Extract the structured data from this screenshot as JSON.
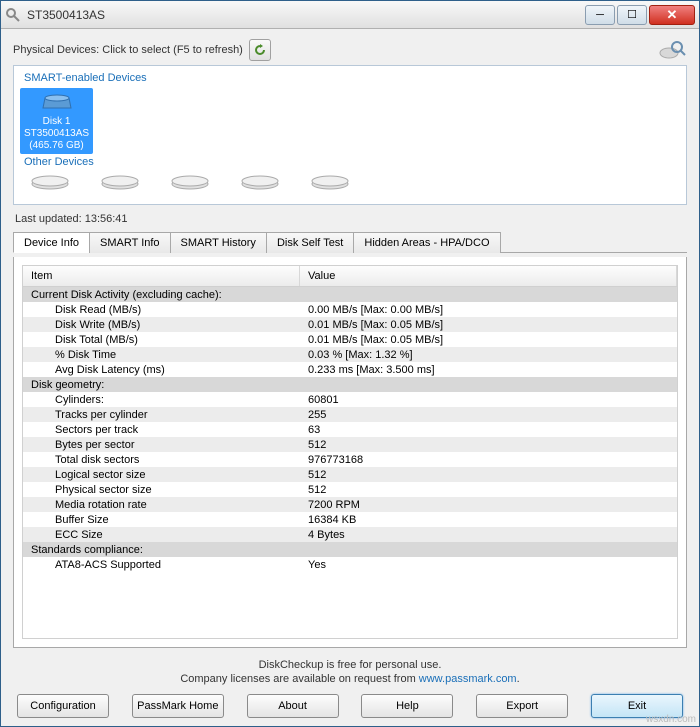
{
  "window": {
    "title": "ST3500413AS"
  },
  "physical": {
    "label": "Physical Devices: Click to select (F5 to refresh)"
  },
  "groups": {
    "smart": "SMART-enabled Devices",
    "other": "Other Devices"
  },
  "selectedDevice": {
    "line1": "Disk 1",
    "line2": "ST3500413AS",
    "line3": "(465.76 GB)"
  },
  "lastUpdated": "Last updated: 13:56:41",
  "tabs": {
    "t0": "Device Info",
    "t1": "SMART Info",
    "t2": "SMART History",
    "t3": "Disk Self Test",
    "t4": "Hidden Areas - HPA/DCO"
  },
  "columns": {
    "item": "Item",
    "value": "Value"
  },
  "rows": {
    "s0": "Current Disk Activity (excluding cache):",
    "r0i": "Disk Read (MB/s)",
    "r0v": "0.00 MB/s   [Max: 0.00 MB/s]",
    "r1i": "Disk Write (MB/s)",
    "r1v": "0.01 MB/s   [Max: 0.05 MB/s]",
    "r2i": "Disk Total (MB/s)",
    "r2v": "0.01 MB/s   [Max: 0.05 MB/s]",
    "r3i": "% Disk Time",
    "r3v": "0.03 %     [Max: 1.32 %]",
    "r4i": "Avg Disk Latency (ms)",
    "r4v": "0.233 ms   [Max: 3.500 ms]",
    "s1": "Disk geometry:",
    "r5i": "Cylinders:",
    "r5v": "60801",
    "r6i": "Tracks per cylinder",
    "r6v": "255",
    "r7i": "Sectors per track",
    "r7v": "63",
    "r8i": "Bytes per sector",
    "r8v": "512",
    "r9i": "Total disk sectors",
    "r9v": "976773168",
    "r10i": "Logical sector size",
    "r10v": "512",
    "r11i": "Physical sector size",
    "r11v": "512",
    "r12i": "Media rotation rate",
    "r12v": "7200 RPM",
    "r13i": "Buffer Size",
    "r13v": "16384 KB",
    "r14i": "ECC Size",
    "r14v": "4 Bytes",
    "s2": "Standards compliance:",
    "r15i": "ATA8-ACS Supported",
    "r15v": "Yes"
  },
  "footer": {
    "line1": "DiskCheckup is free for personal use.",
    "line2a": "Company licenses are available on request from ",
    "link": "www.passmark.com",
    "line2b": "."
  },
  "buttons": {
    "config": "Configuration",
    "home": "PassMark Home",
    "about": "About",
    "help": "Help",
    "export": "Export",
    "exit": "Exit"
  },
  "watermark": "wsxdn.com"
}
